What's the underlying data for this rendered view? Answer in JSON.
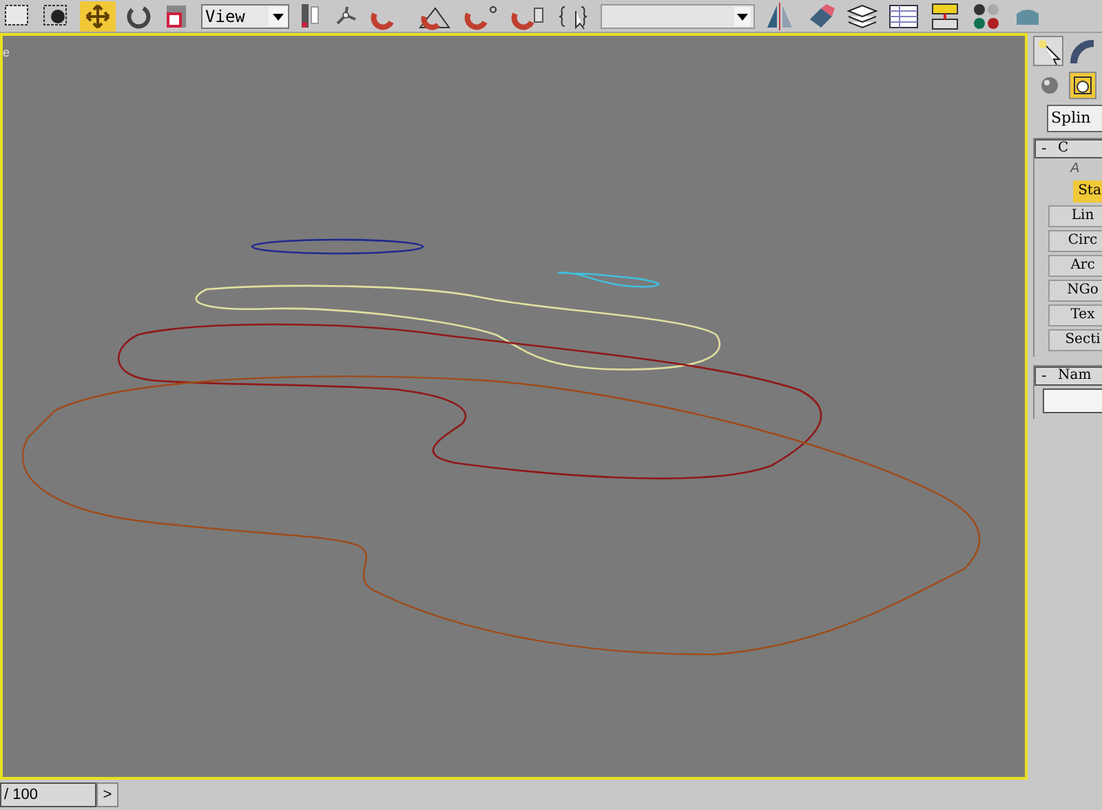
{
  "toolbar": {
    "view_dropdown": "View"
  },
  "viewport": {
    "label": "e"
  },
  "command_panel": {
    "category_buttons": [
      {
        "selected": false
      },
      {
        "selected": true
      }
    ],
    "type_dropdown": "Splin",
    "rollouts": [
      {
        "toggle": "-",
        "title": "C",
        "subtitle": "A",
        "buttons": [
          {
            "label": "Sta",
            "selected": true
          },
          {
            "label": "Lin",
            "selected": false
          },
          {
            "label": "Circ",
            "selected": false
          },
          {
            "label": "Arc",
            "selected": false
          },
          {
            "label": "NGo",
            "selected": false
          },
          {
            "label": "Tex",
            "selected": false
          },
          {
            "label": "Secti",
            "selected": false
          }
        ]
      },
      {
        "toggle": "-",
        "title": "Nam"
      }
    ]
  },
  "timeline": {
    "frame_field": "/ 100",
    "next_button": ">"
  }
}
